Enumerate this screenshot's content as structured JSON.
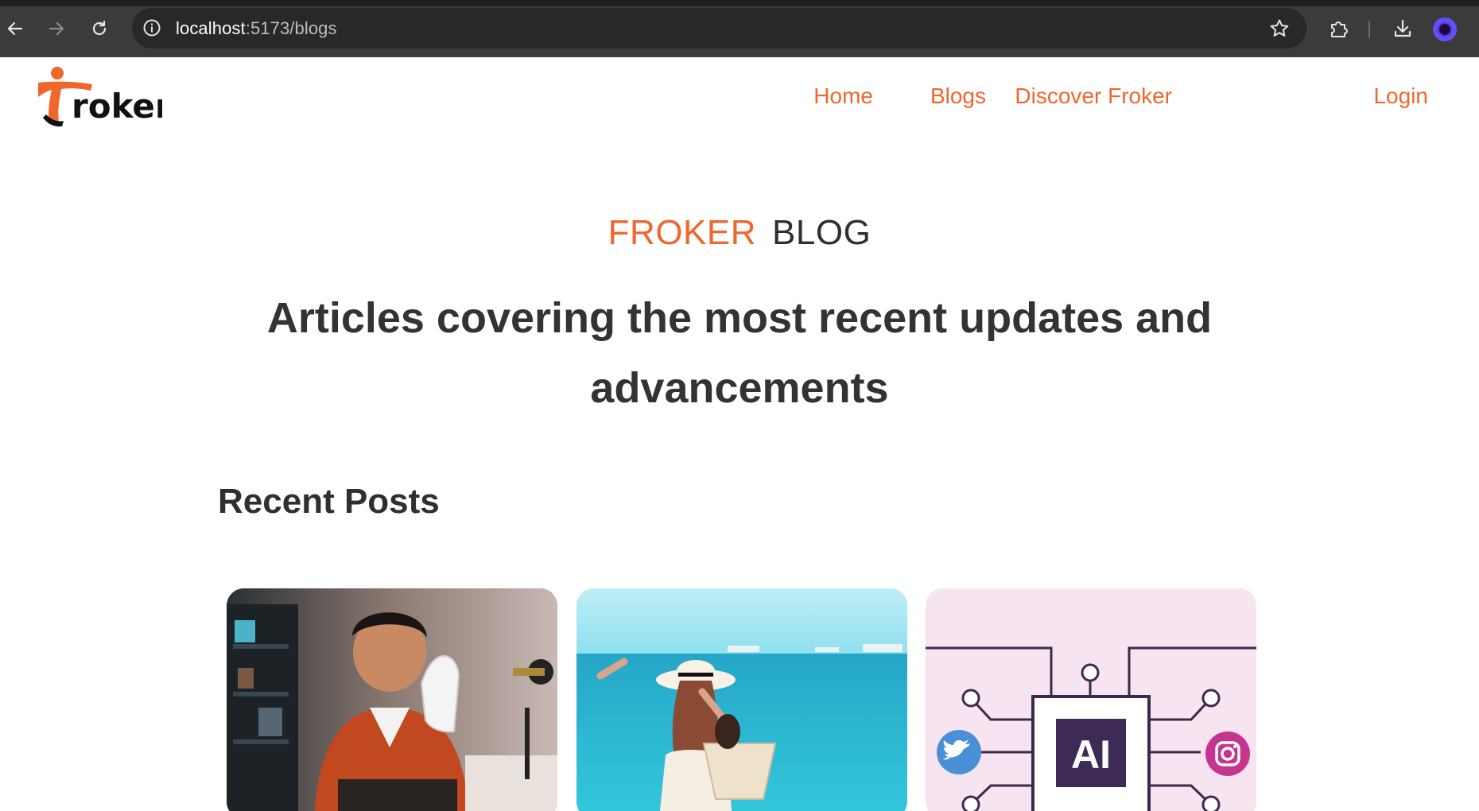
{
  "browser": {
    "url_host": "localhost",
    "url_path": ":5173/blogs"
  },
  "header": {
    "logo_text": "roker",
    "nav": [
      {
        "label": "Home"
      },
      {
        "label": "Blogs"
      },
      {
        "label": "Discover Froker"
      },
      {
        "label": "Login"
      }
    ]
  },
  "hero": {
    "eyebrow_accent": "FROKER",
    "eyebrow_rest": "BLOG",
    "headline": "Articles covering the most recent updates and advancements"
  },
  "recent": {
    "title": "Recent Posts",
    "cards": [
      {
        "image": "man-holding-sneaker-photo"
      },
      {
        "image": "woman-at-beach-photo"
      },
      {
        "image": "ai-chip-social-icons-illustration",
        "chip_text": "AI"
      }
    ]
  },
  "colors": {
    "accent": "#f0662d",
    "text": "#333333",
    "card3_bg": "#f6e4f1"
  }
}
